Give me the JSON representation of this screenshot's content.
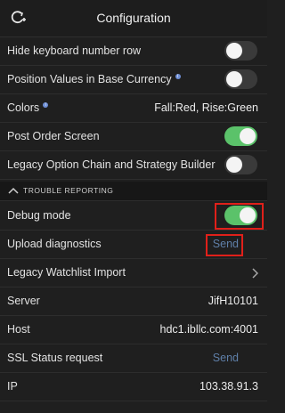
{
  "header": {
    "title": "Configuration"
  },
  "rows": {
    "hide_keyboard": {
      "label": "Hide keyboard number row",
      "toggle": "off"
    },
    "position_values": {
      "label": "Position Values in Base Currency",
      "toggle": "off"
    },
    "colors": {
      "label": "Colors",
      "value": "Fall:Red, Rise:Green"
    },
    "post_order": {
      "label": "Post Order Screen",
      "toggle": "on"
    },
    "legacy_option": {
      "label": "Legacy Option Chain and Strategy Builder",
      "toggle": "off"
    }
  },
  "trouble_section": {
    "title": "TROUBLE REPORTING"
  },
  "trouble_rows": {
    "debug_mode": {
      "label": "Debug mode",
      "toggle": "on"
    },
    "upload_diag": {
      "label": "Upload diagnostics",
      "action": "Send"
    },
    "legacy_watchlist": {
      "label": "Legacy Watchlist Import"
    },
    "server": {
      "label": "Server",
      "value": "JifH10101"
    },
    "host": {
      "label": "Host",
      "value": "hdc1.ibllc.com:4001"
    },
    "ssl_status": {
      "label": "SSL Status request",
      "action": "Send"
    },
    "ip": {
      "label": "IP",
      "value": "103.38.91.3"
    }
  },
  "colors": {
    "toggle_on": "#5bc26a",
    "toggle_off": "#3a3a3a",
    "highlight": "#e0201a",
    "link": "#5f7fa8"
  },
  "icons": {
    "back": "refresh-plus-icon",
    "info": "info-icon",
    "chevron": "chevron-right-icon"
  }
}
